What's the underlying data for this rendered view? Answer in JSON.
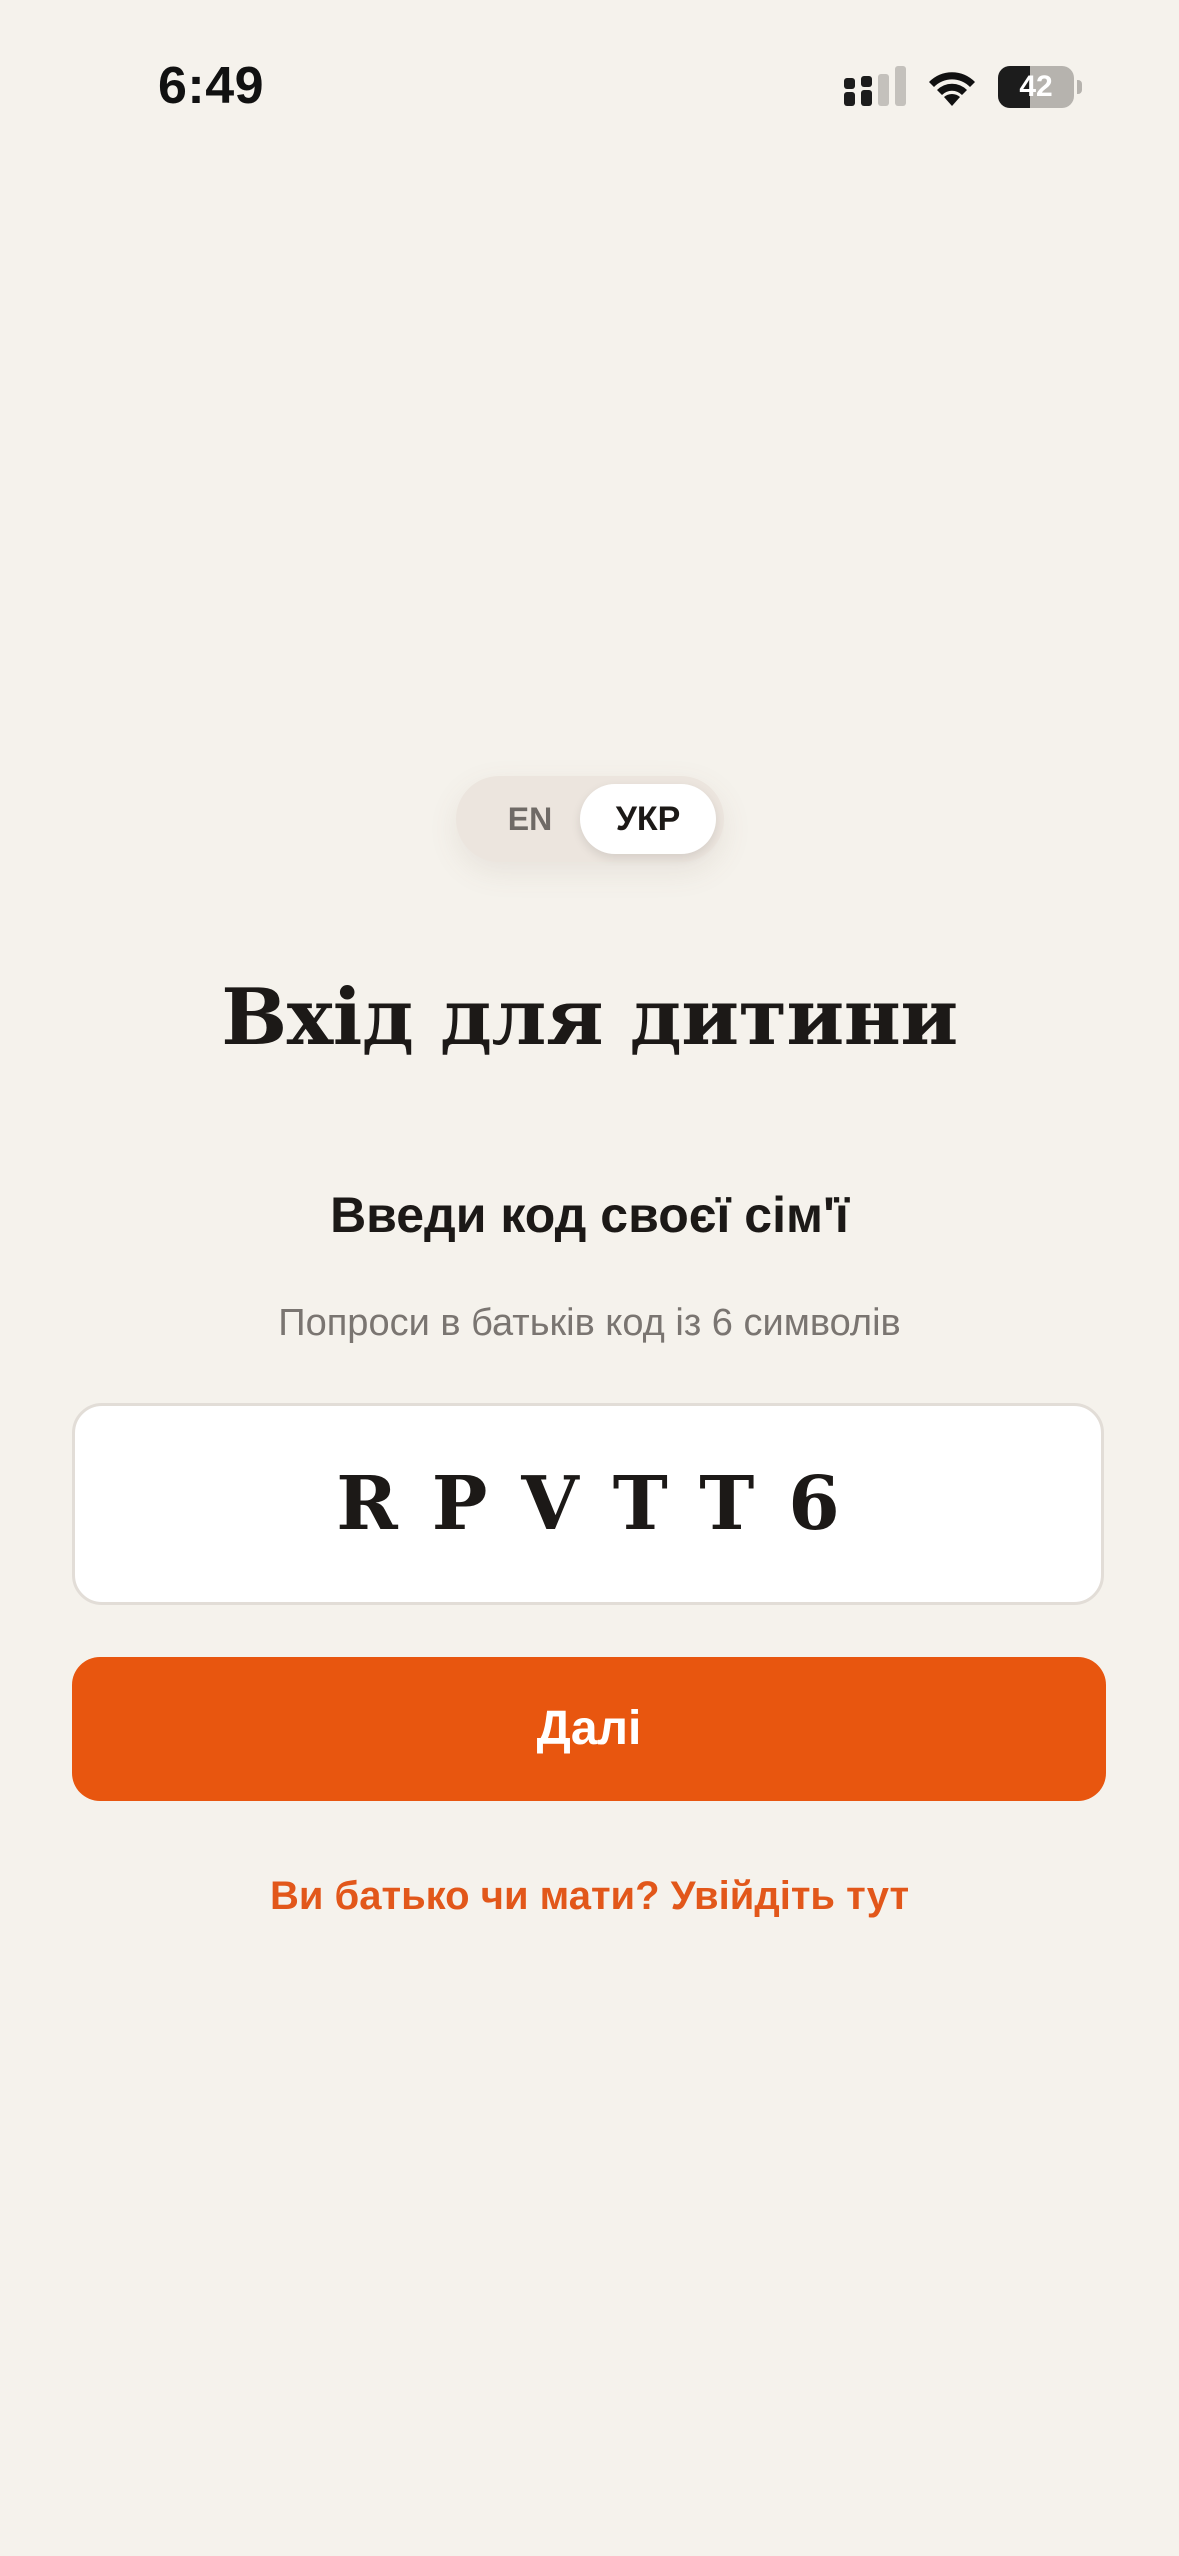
{
  "status_bar": {
    "time": "6:49",
    "battery_level": "42",
    "battery_fraction": 0.42,
    "icons": [
      "cellular-signal-icon",
      "wifi-icon",
      "battery-icon"
    ]
  },
  "language_toggle": {
    "options": [
      "EN",
      "УКР"
    ],
    "selected": "УКР"
  },
  "title": "Вхід для дитини",
  "subtitle": "Введи код своєї сім'ї",
  "hint": "Попроси в батьків код із 6 символів",
  "code_input": {
    "value": "RPVTT6"
  },
  "next_button": {
    "label": "Далі"
  },
  "parent_link": {
    "label": "Ви батько чи мати? Увійдіть тут"
  },
  "colors": {
    "background": "#f5f2ec",
    "accent": "#e8560f",
    "link": "#e2571a",
    "text": "#1c1917",
    "muted_text": "#7a7571"
  }
}
